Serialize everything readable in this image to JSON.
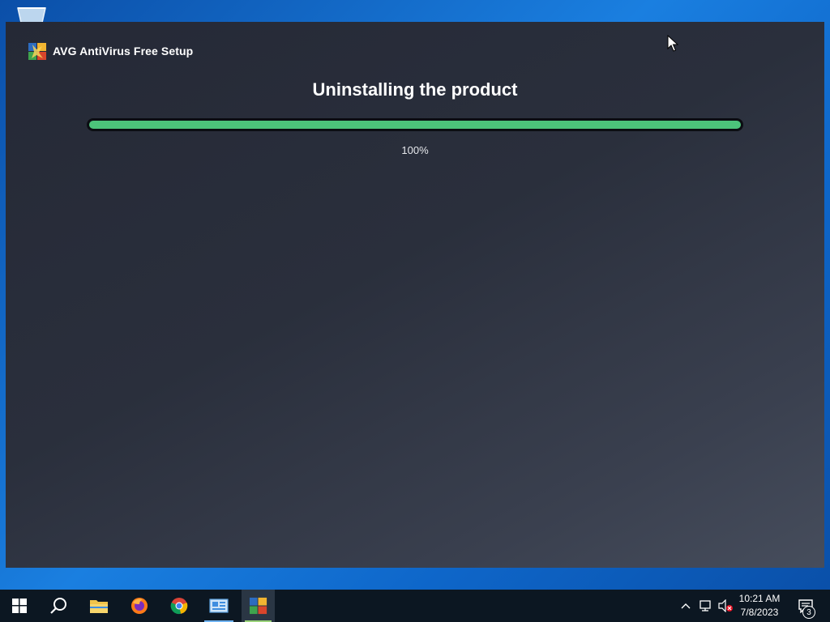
{
  "window": {
    "app_title": "AVG AntiVirus Free Setup",
    "heading": "Uninstalling the product",
    "progress": {
      "value_percent": 100,
      "label": "100%",
      "color": "#4cc37a"
    }
  },
  "taskbar": {
    "pinned": [
      {
        "name": "start-button",
        "icon": "windows-logo-icon"
      },
      {
        "name": "search-button",
        "icon": "search-icon"
      },
      {
        "name": "file-explorer-button",
        "icon": "folder-icon"
      },
      {
        "name": "firefox-button",
        "icon": "firefox-icon"
      },
      {
        "name": "chrome-button",
        "icon": "chrome-icon"
      },
      {
        "name": "control-panel-button",
        "icon": "control-panel-icon"
      },
      {
        "name": "avg-setup-button",
        "icon": "avg-logo-icon",
        "active": true
      }
    ],
    "clock": {
      "time": "10:21 AM",
      "date": "7/8/2023"
    },
    "notifications_count": "3"
  }
}
